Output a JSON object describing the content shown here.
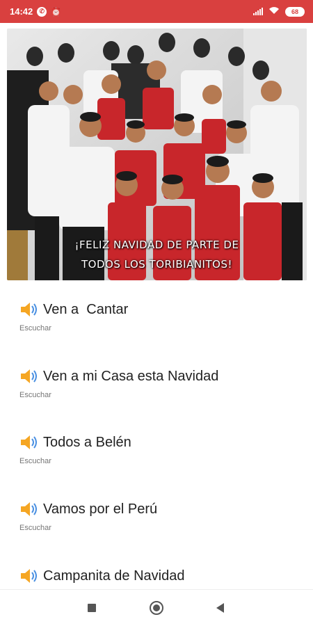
{
  "status_bar": {
    "time": "14:42",
    "battery": "68",
    "icons": [
      "whatsapp-icon",
      "alarm-icon",
      "signal-icon",
      "wifi-icon",
      "battery-icon"
    ],
    "background_color": "#d9403f"
  },
  "banner": {
    "caption_line1": "¡FELIZ NAVIDAD DE PARTE DE",
    "caption_line2": "TODOS LOS TORIBIANITOS!"
  },
  "songs": [
    {
      "title": "Ven a  Cantar",
      "subtitle": "Escuchar"
    },
    {
      "title": "Ven a mi Casa esta Navidad",
      "subtitle": "Escuchar"
    },
    {
      "title": "Todos a Belén",
      "subtitle": "Escuchar"
    },
    {
      "title": "Vamos por el Perú",
      "subtitle": "Escuchar"
    },
    {
      "title": "Campanita de Navidad",
      "subtitle": ""
    }
  ],
  "nav_bar": {
    "icons": [
      "recents-square-icon",
      "home-circle-icon",
      "back-triangle-icon"
    ]
  }
}
